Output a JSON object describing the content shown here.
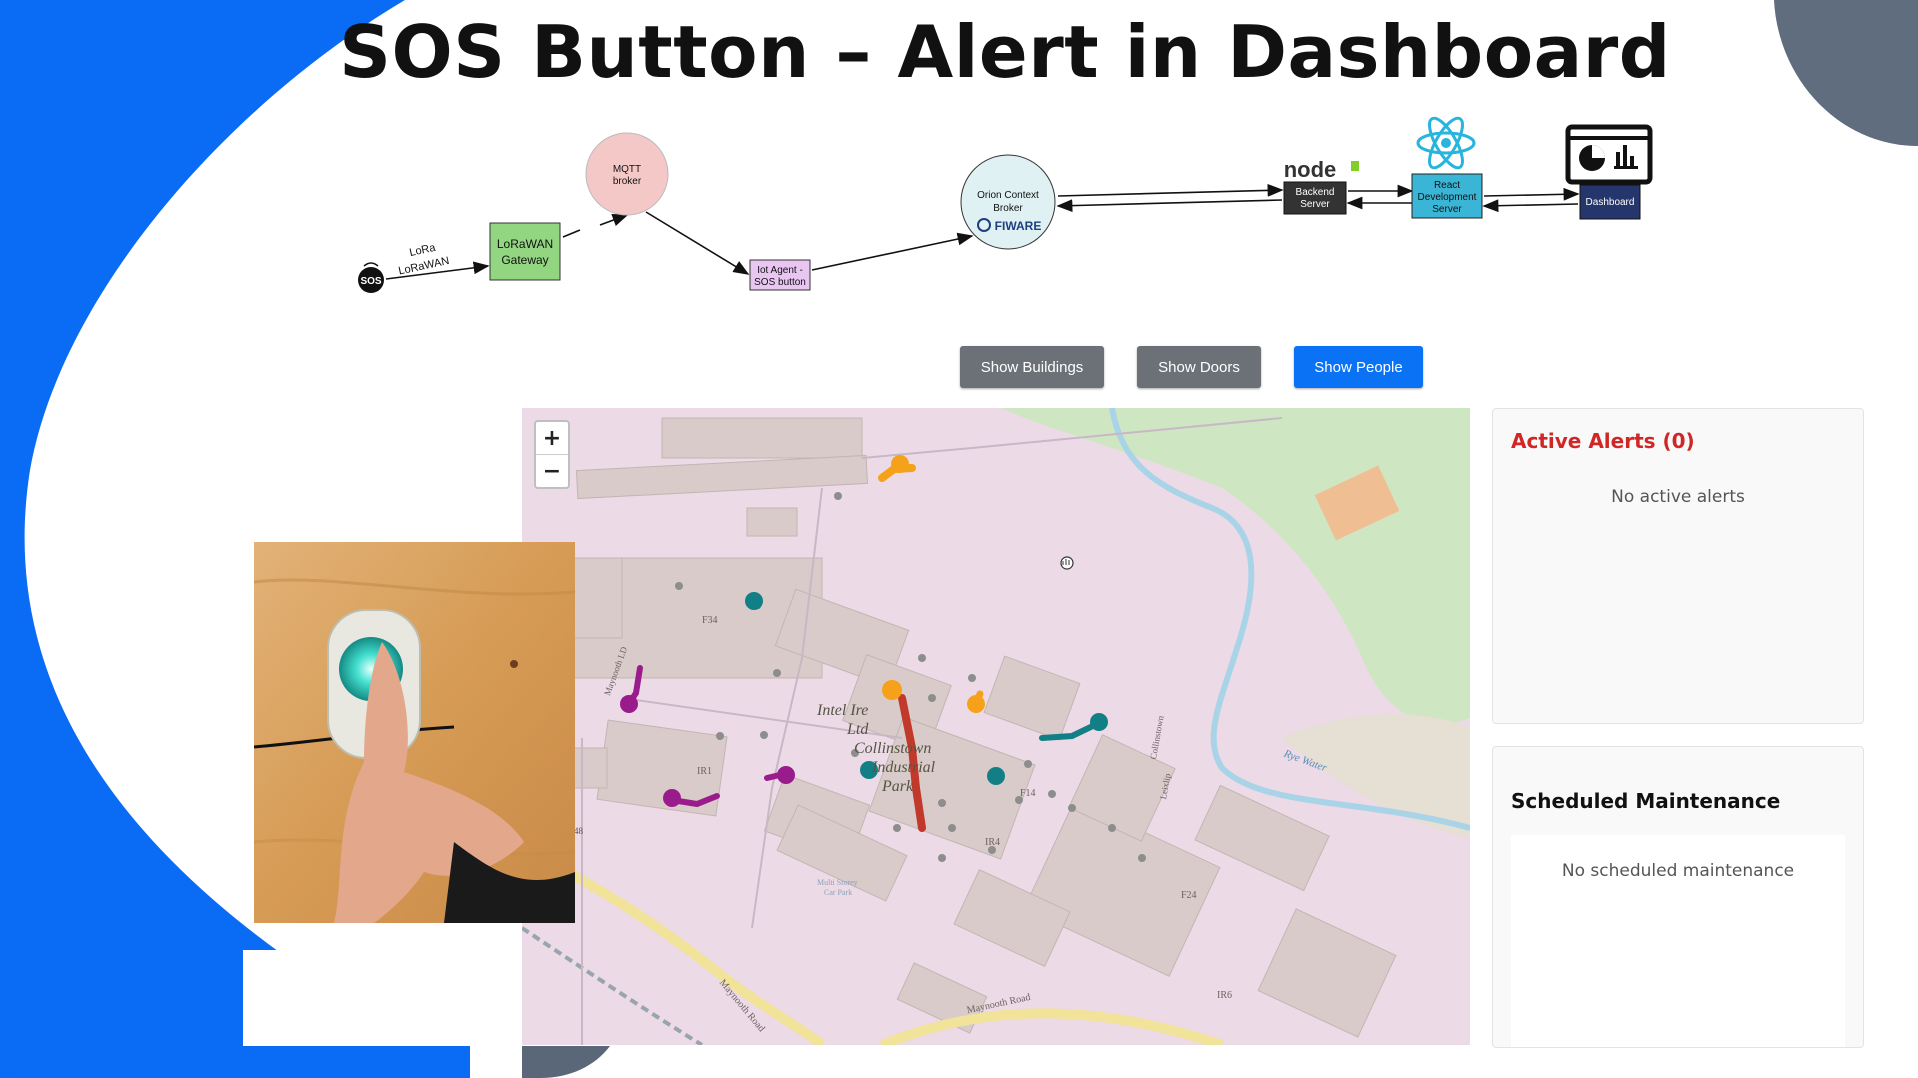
{
  "slide": {
    "title": "SOS Button – Alert in Dashboard"
  },
  "architecture": {
    "sos_icon": "SOS",
    "lora_label_1": "LoRa",
    "lora_label_2": "LoRaWAN",
    "gateway_line_1": "LoRaWAN",
    "gateway_line_2": "Gateway",
    "mqtt_line_1": "MQTT",
    "mqtt_line_2": "broker",
    "iot_agent_line_1": "Iot Agent -",
    "iot_agent_line_2": "SOS button",
    "orion_line_1": "Orion Context",
    "orion_line_2": "Broker",
    "fiware_logo": "FIWARE",
    "node_logo": "node",
    "backend_line_1": "Backend",
    "backend_line_2": "Server",
    "react_line_1": "React",
    "react_line_2": "Development",
    "react_line_3": "Server",
    "dashboard_label": "Dashboard"
  },
  "toolbar": {
    "show_buildings": "Show Buildings",
    "show_doors": "Show Doors",
    "show_people": "Show People"
  },
  "map": {
    "zoom_in": "+",
    "zoom_out": "−",
    "labels": {
      "f34": "F34",
      "intel_1": "Intel Ire",
      "intel_2": "Ltd",
      "park_1": "Collinstown",
      "park_2": "Industrial",
      "park_3": "Park",
      "ir1": "IR1",
      "f14": "F14",
      "ir4": "IR4",
      "f24": "F24",
      "ir6": "IR6",
      "rye_water": "Rye Water",
      "maynooth_road_1": "Maynooth Road",
      "maynooth_road_2": "Maynooth Road",
      "collinstown_road": "Collinstown",
      "leixlip": "Leixlip",
      "maynooth_ld": "Maynooth LD",
      "multi_storey_1": "Multi Storey",
      "multi_storey_2": "Car Park",
      "road_48": "48"
    }
  },
  "alerts": {
    "title": "Active Alerts (0)",
    "empty": "No active alerts"
  },
  "maintenance": {
    "title": "Scheduled Maintenance",
    "empty": "No scheduled maintenance"
  },
  "colors": {
    "accent_blue": "#0a72f5",
    "slate": "#5f6d7e",
    "alert_red": "#d02626",
    "track_orange": "#f5a21a",
    "track_teal": "#127f86",
    "track_purple": "#9a1c8c",
    "track_red": "#c0392b"
  }
}
